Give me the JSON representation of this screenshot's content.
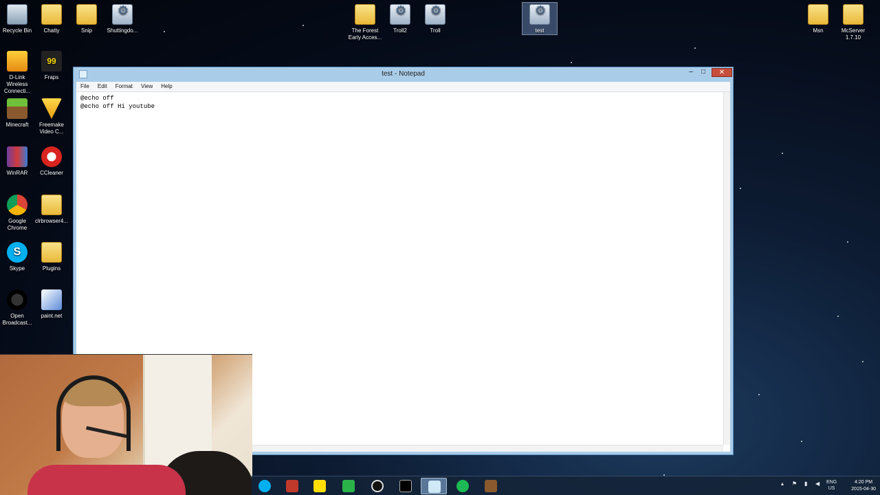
{
  "desktop": {
    "icons": [
      {
        "label": "Recycle Bin",
        "icon": "recycle-bin-icon"
      },
      {
        "label": "Chatty",
        "icon": "folder-icon"
      },
      {
        "label": "Snip",
        "icon": "folder-icon"
      },
      {
        "label": "Shuttingdo...",
        "icon": "batch-file-icon"
      },
      {
        "label": "The Forest Early Acces...",
        "icon": "folder-icon"
      },
      {
        "label": "Troll2",
        "icon": "batch-file-icon"
      },
      {
        "label": "Troll",
        "icon": "batch-file-icon"
      },
      {
        "label": "test",
        "icon": "batch-file-icon"
      },
      {
        "label": "Msn",
        "icon": "folder-icon"
      },
      {
        "label": "McServer 1.7.10",
        "icon": "folder-icon"
      },
      {
        "label": "D-Link Wireless Connecti...",
        "icon": "dlink-icon"
      },
      {
        "label": "Fraps",
        "icon": "fraps-icon"
      },
      {
        "label": "Minecraft",
        "icon": "minecraft-icon"
      },
      {
        "label": "Freemake Video C...",
        "icon": "freemake-icon"
      },
      {
        "label": "WinRAR",
        "icon": "winrar-icon"
      },
      {
        "label": "CCleaner",
        "icon": "ccleaner-icon"
      },
      {
        "label": "Google Chrome",
        "icon": "chrome-icon"
      },
      {
        "label": "clrbrowser4...",
        "icon": "folder-icon"
      },
      {
        "label": "Skype",
        "icon": "skype-icon"
      },
      {
        "label": "Plugins",
        "icon": "folder-icon"
      },
      {
        "label": "Open Broadcast...",
        "icon": "obs-icon"
      },
      {
        "label": "paint.net",
        "icon": "paintnet-icon"
      }
    ]
  },
  "notepad": {
    "title": "test - Notepad",
    "menu": [
      "File",
      "Edit",
      "Format",
      "View",
      "Help"
    ],
    "lines": [
      "@echo off",
      "@echo off Hi youtube"
    ]
  },
  "taskbar": {
    "apps": [
      "skype-icon",
      "photo-app-icon",
      "fraps-icon",
      "store-icon",
      "obs-icon",
      "cmd-icon",
      "notepad-icon",
      "spotify-icon",
      "minecraft-icon"
    ],
    "lang_top": "ENG",
    "lang_bottom": "US",
    "time": "4:20 PM",
    "date": "2015-04-30"
  },
  "colors": {
    "accent_close": "#c74d3c",
    "window_frame": "#a9cde9"
  }
}
